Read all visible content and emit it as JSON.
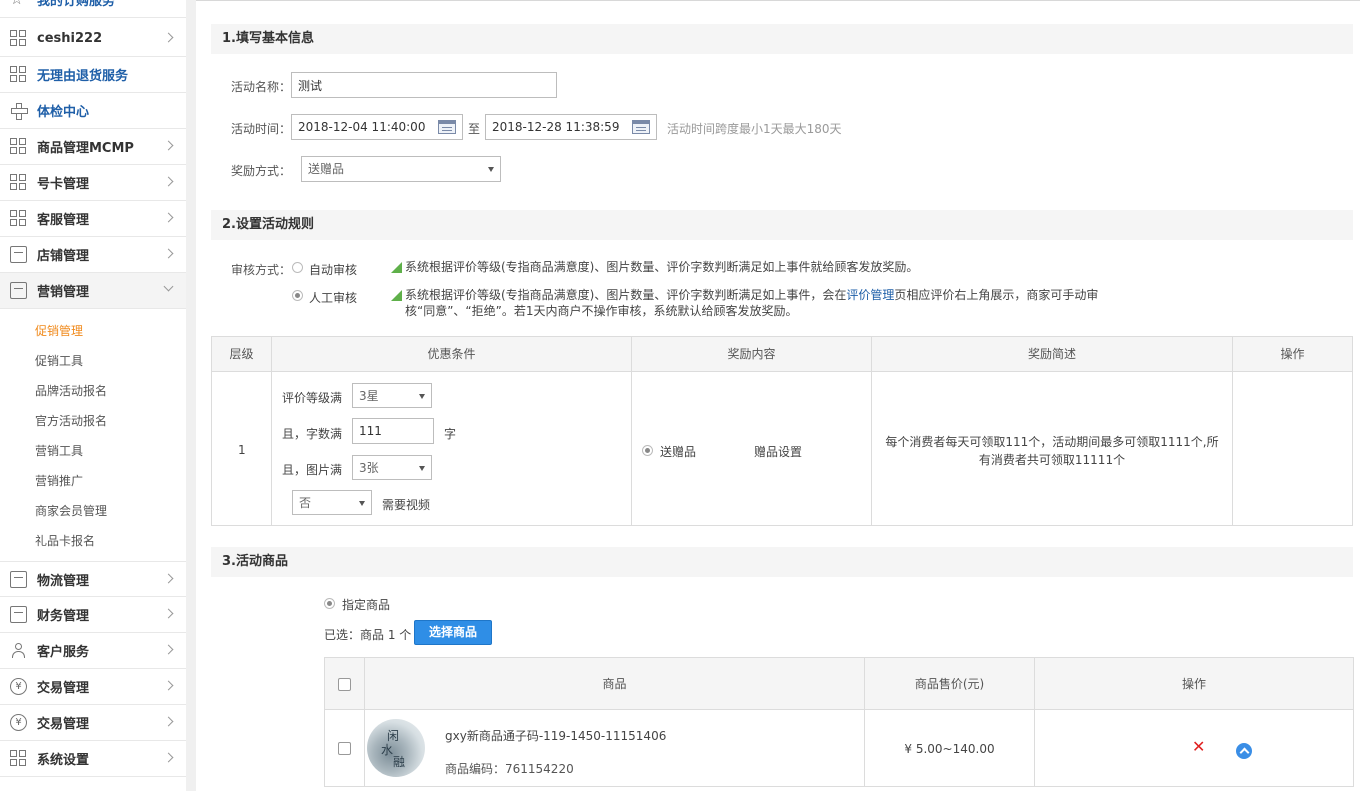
{
  "sidebar": {
    "items": [
      {
        "label": "我的订购服务"
      },
      {
        "label": "ceshi222"
      },
      {
        "label": "无理由退货服务"
      },
      {
        "label": "体检中心"
      },
      {
        "label": "商品管理MCMP"
      },
      {
        "label": "号卡管理"
      },
      {
        "label": "客服管理"
      },
      {
        "label": "店铺管理"
      },
      {
        "label": "营销管理"
      },
      {
        "label": "物流管理"
      },
      {
        "label": "财务管理"
      },
      {
        "label": "客户服务"
      },
      {
        "label": "交易管理"
      },
      {
        "label": "交易管理"
      },
      {
        "label": "系统设置"
      }
    ],
    "sub_items": [
      "促销管理",
      "促销工具",
      "品牌活动报名",
      "官方活动报名",
      "营销工具",
      "营销推广",
      "商家会员管理",
      "礼品卡报名"
    ],
    "yen_symbol": "¥"
  },
  "section1": {
    "title": "1.填写基本信息",
    "name_label": "活动名称：",
    "name_value": "测试",
    "time_label": "活动时间：",
    "start_time": "2018-12-04 11:40:00",
    "to_label": "至",
    "end_time": "2018-12-28 11:38:59",
    "time_hint": "活动时间跨度最小1天最大180天",
    "reward_label": "奖励方式：",
    "reward_value": "送赠品"
  },
  "section2": {
    "title": "2.设置活动规则",
    "review_label": "审核方式：",
    "auto_label": "自动审核",
    "auto_desc": "系统根据评价等级(专指商品满意度)、图片数量、评价字数判断满足如上事件就给顾客发放奖励。",
    "manual_label": "人工审核",
    "manual_desc_a": "系统根据评价等级(专指商品满意度)、图片数量、评价字数判断满足如上事件，会在",
    "manual_desc_link": "评价管理",
    "manual_desc_b": "页相应评价右上角展示，商家可手动审",
    "manual_desc_c": "核“同意”、“拒绝”。若1天内商户不操作审核，系统默认给顾客发放奖励。",
    "table": {
      "headers": [
        "层级",
        "优惠条件",
        "奖励内容",
        "奖励简述",
        "操作"
      ],
      "row": {
        "level": "1",
        "rating_label": "评价等级满",
        "rating_value": "3星",
        "words_label": "且，字数满",
        "words_value": "111",
        "words_unit": "字",
        "pics_label": "且，图片满",
        "pics_value": "3张",
        "video_value": "否",
        "video_label": "需要视频",
        "reward_option": "送赠品",
        "gift_link": "赠品设置",
        "summary_line1": "每个消费者每天可领取111个，活动期间最多可领取1111个,所",
        "summary_line2": "有消费者共可领取11111个"
      }
    }
  },
  "section3": {
    "title": "3.活动商品",
    "designated_label": "指定商品",
    "selected_text": "已选：商品 1 个",
    "choose_button": "选择商品",
    "table": {
      "headers": [
        "商品",
        "商品售价(元)",
        "操作"
      ],
      "row": {
        "name": "gxy新商品通子码-119-1450-11151406",
        "code": "商品编码：761154220",
        "price": "¥ 5.00~140.00",
        "thumb_chars": [
          "闲",
          "水",
          "融"
        ],
        "delete_symbol": "✕"
      }
    }
  }
}
